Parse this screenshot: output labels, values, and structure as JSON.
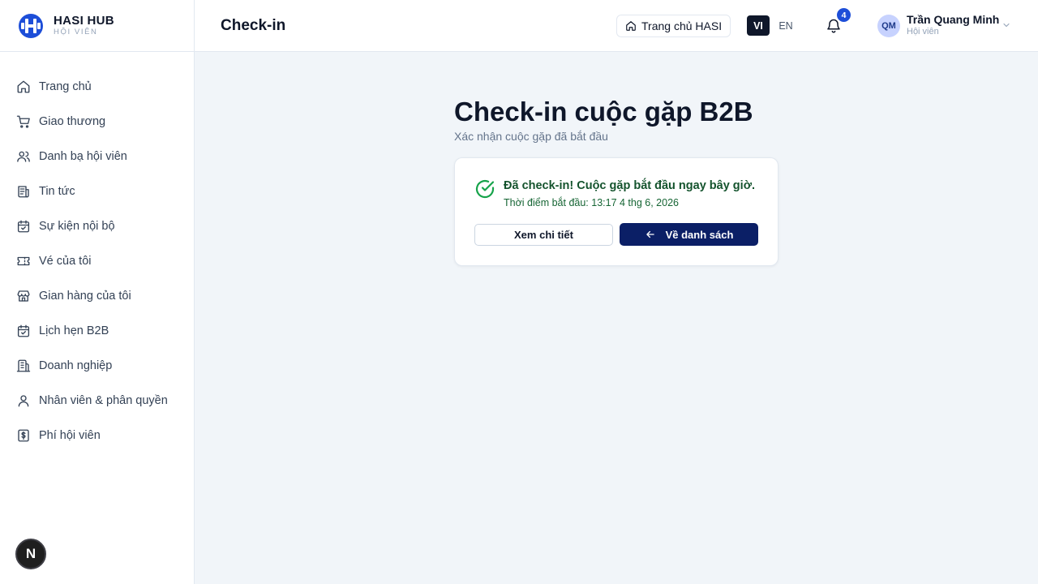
{
  "brand": {
    "name": "HASI HUB",
    "subtitle": "HỘI VIÊN",
    "logo_icon": "hasi-logo-icon",
    "accent": "#1d4ed8"
  },
  "sidebar": {
    "items": [
      {
        "label": "Trang chủ",
        "icon": "home-icon"
      },
      {
        "label": "Giao thương",
        "icon": "cart-icon"
      },
      {
        "label": "Danh bạ hội viên",
        "icon": "users-icon"
      },
      {
        "label": "Tin tức",
        "icon": "newspaper-icon"
      },
      {
        "label": "Sự kiện nội bộ",
        "icon": "calendar-check-icon"
      },
      {
        "label": "Vé của tôi",
        "icon": "ticket-icon"
      },
      {
        "label": "Gian hàng của tôi",
        "icon": "store-icon"
      },
      {
        "label": "Lịch hẹn B2B",
        "icon": "calendar-check-icon"
      },
      {
        "label": "Doanh nghiệp",
        "icon": "building-icon"
      },
      {
        "label": "Nhân viên & phân quyền",
        "icon": "user-icon"
      },
      {
        "label": "Phí hội viên",
        "icon": "dollar-icon"
      }
    ]
  },
  "dev_badge": {
    "label": "N"
  },
  "header": {
    "title": "Check-in",
    "home_button": "Trang chủ HASI",
    "lang_active": "VI",
    "lang_other": "EN",
    "notification_count": "4",
    "user": {
      "initials": "QM",
      "name": "Trần Quang Minh",
      "role": "Hội viên"
    }
  },
  "main": {
    "title": "Check-in cuộc gặp B2B",
    "subtitle": "Xác nhận cuộc gặp đã bắt đầu",
    "card": {
      "success_title": "Đã check-in! Cuộc gặp bắt đầu ngay bây giờ.",
      "start_time": "Thời điểm bắt đầu: 13:17 4 thg 6, 2026",
      "detail_button": "Xem chi tiết",
      "back_button": "Về danh sách"
    }
  },
  "colors": {
    "primary": "#0b1f66",
    "success": "#16a34a",
    "text": "#0f172a",
    "muted": "#64748b"
  }
}
